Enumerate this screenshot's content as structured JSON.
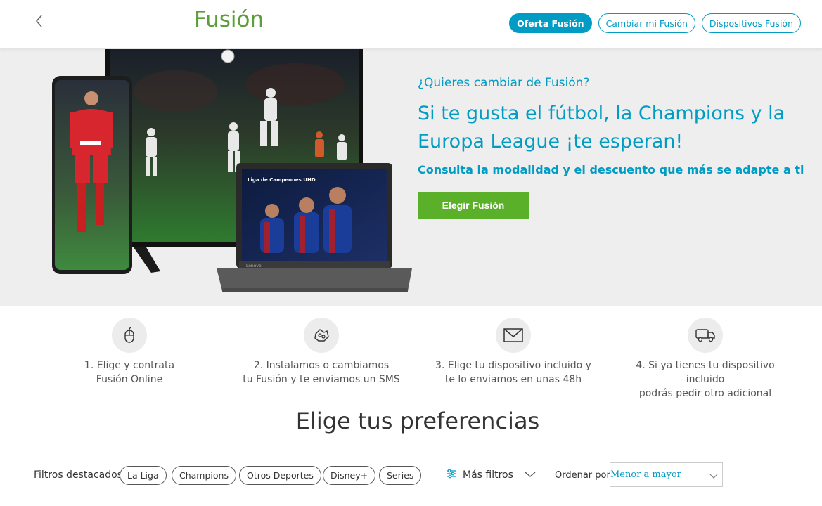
{
  "header": {
    "title": "Fusión",
    "nav": [
      {
        "label": "Oferta Fusión",
        "active": true
      },
      {
        "label": "Cambiar mi Fusión",
        "active": false
      },
      {
        "label": "Dispositivos Fusión",
        "active": false
      }
    ]
  },
  "hero": {
    "question": "¿Quieres cambiar de Fusión?",
    "headline": "Si te gusta el fútbol, la Champions y la Europa League ¡te esperan!",
    "subheadline": "Consulta la modalidad y el descuento que más se adapte a ti",
    "cta_label": "Elegir Fusión",
    "laptop_screen_text": "Liga de Campeones UHD",
    "laptop_brand": "Lenovo"
  },
  "steps": [
    {
      "icon": "mouse-icon",
      "line1": "1. Elige y contrata",
      "line2": "Fusión Online"
    },
    {
      "icon": "installation-icon",
      "line1": "2. Instalamos o cambiamos",
      "line2": "tu Fusión y te enviamos un SMS"
    },
    {
      "icon": "envelope-icon",
      "line1": "3. Elige tu dispositivo incluido y",
      "line2": "te lo enviamos en unas 48h"
    },
    {
      "icon": "delivery-truck-icon",
      "line1": "4. Si ya tienes tu dispositivo incluido",
      "line2": "podrás pedir otro adicional"
    }
  ],
  "preferences": {
    "title": "Elige tus preferencias",
    "filters_label": "Filtros destacados",
    "chips": [
      "La Liga",
      "Champions",
      "Otros Deportes",
      "Disney+",
      "Series"
    ],
    "more_filters_label": "Más filtros",
    "sort_label": "Ordenar por:",
    "sort_value": "Menor a mayor"
  },
  "colors": {
    "brand_blue": "#019cc4",
    "brand_green": "#5b9e3a",
    "cta_green": "#5bb029",
    "hero_bg": "#eeeeee"
  }
}
